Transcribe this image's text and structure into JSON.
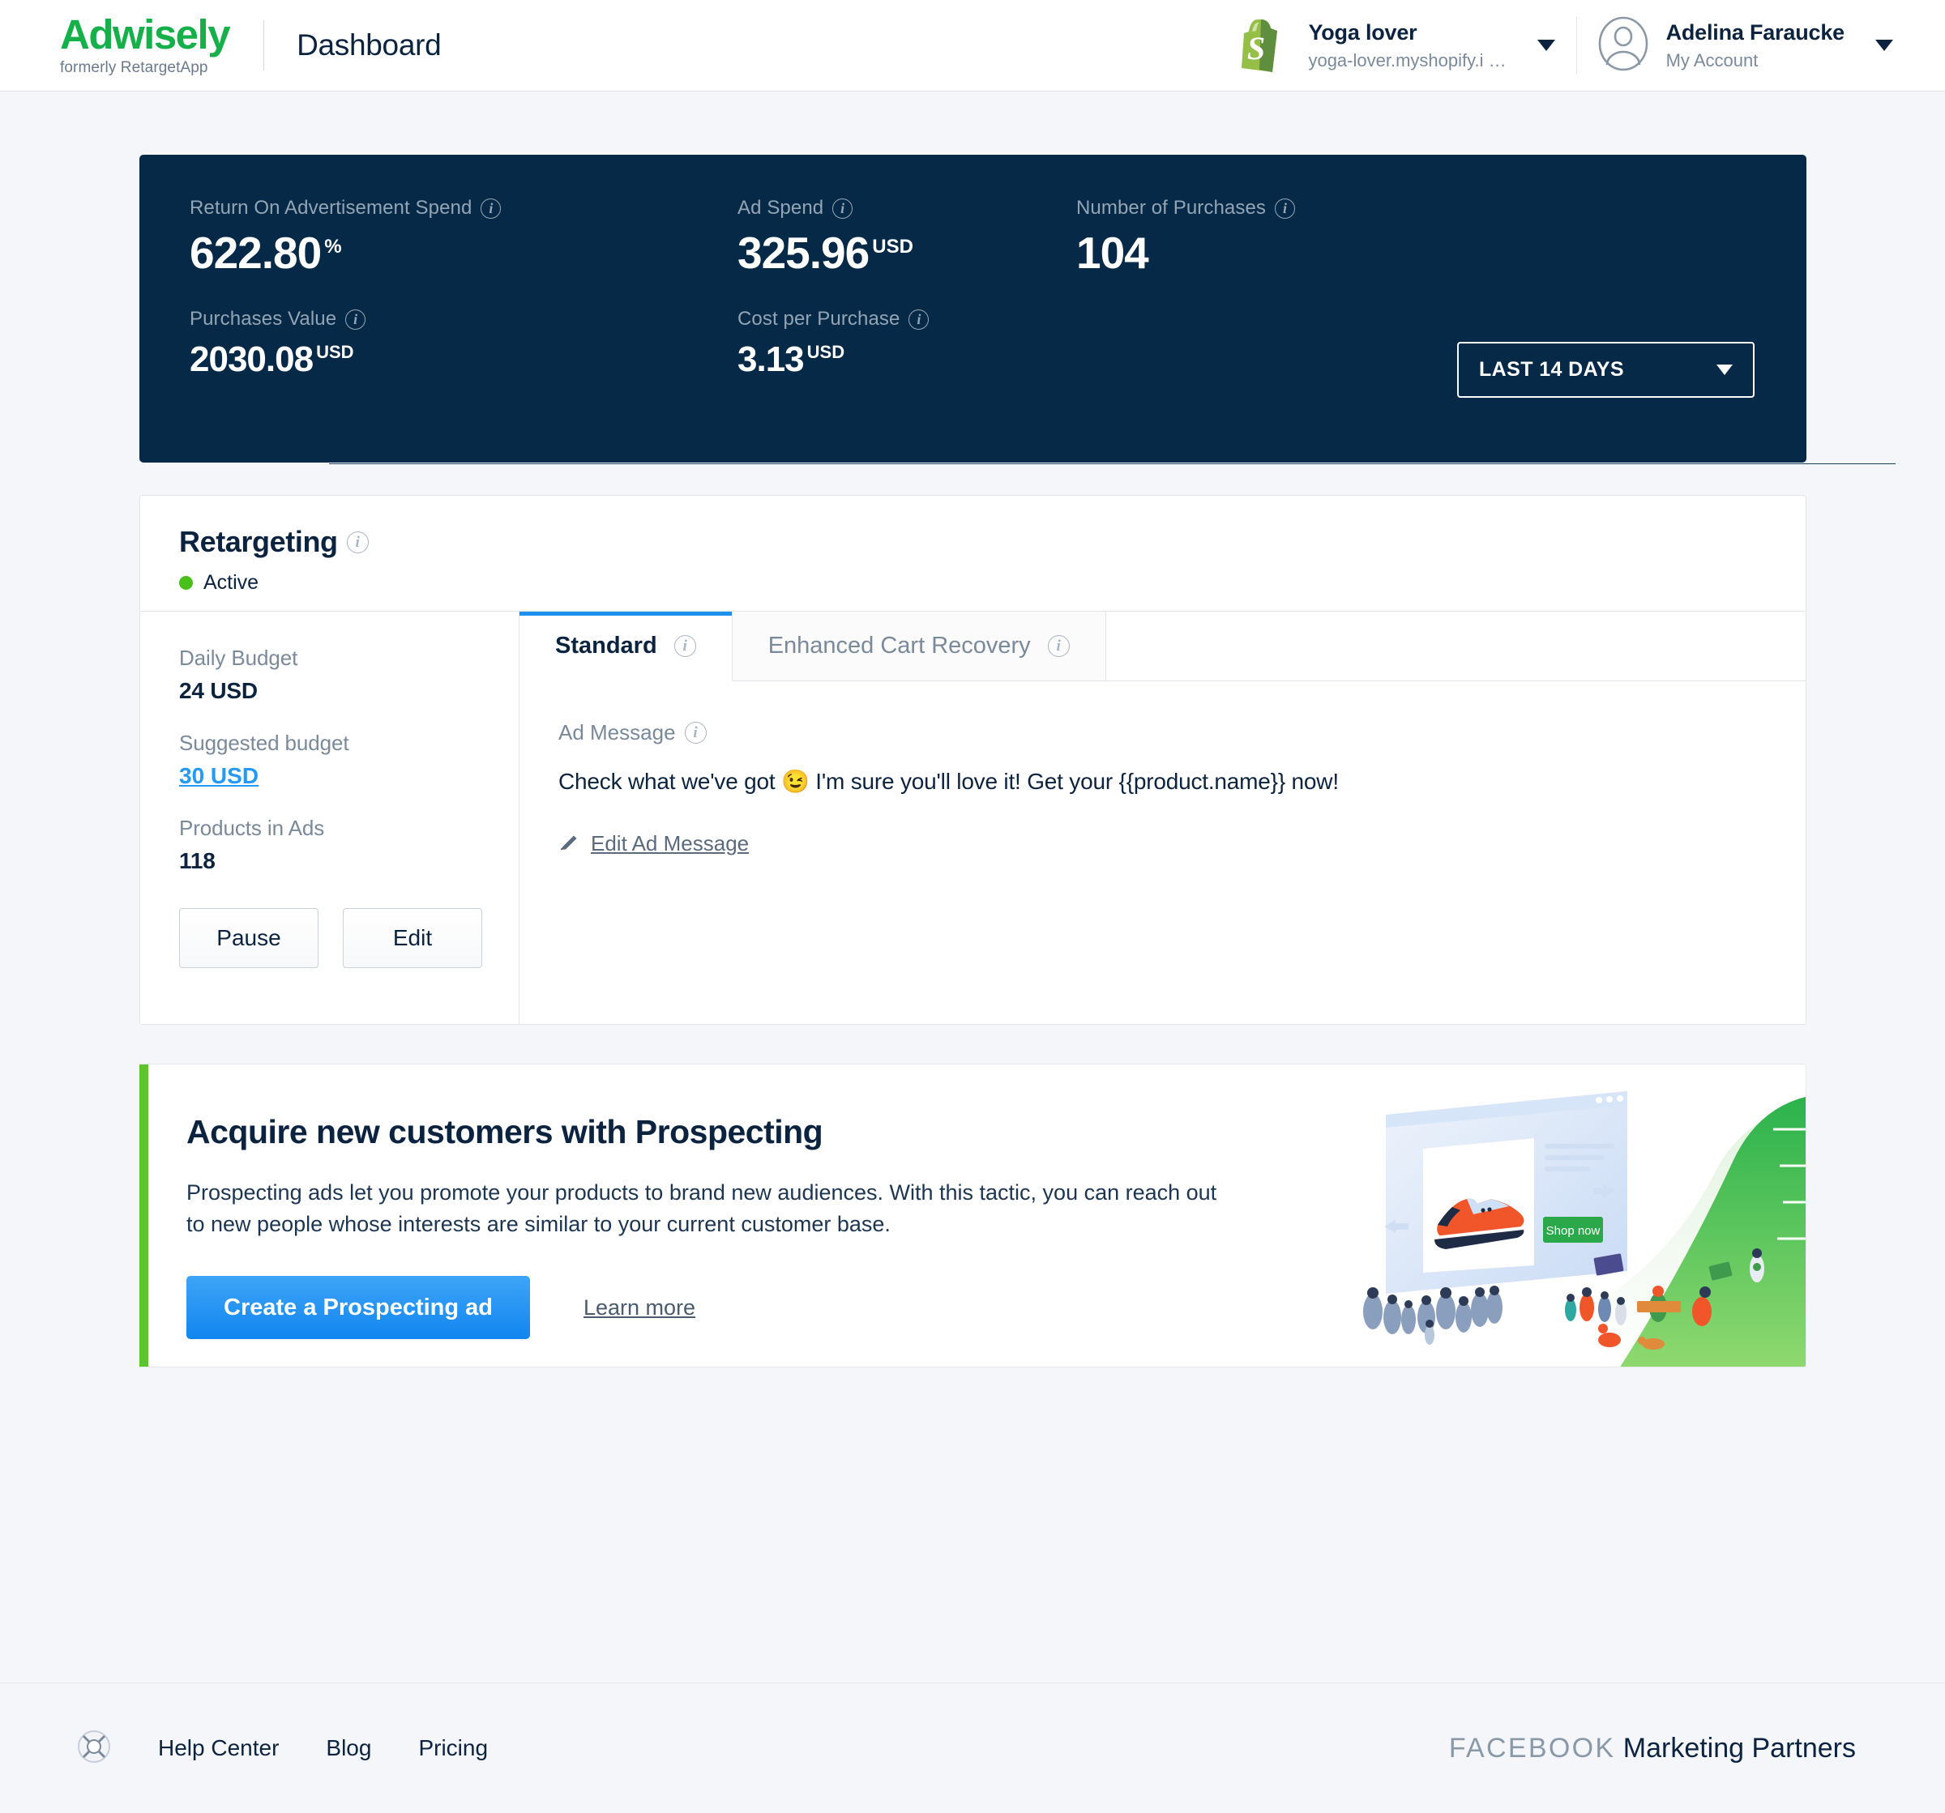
{
  "header": {
    "logo_word": "Adwisely",
    "logo_sub": "formerly RetargetApp",
    "page_title": "Dashboard",
    "store": {
      "name": "Yoga lover",
      "domain": "yoga-lover.myshopify.i …"
    },
    "account": {
      "name": "Adelina Faraucke",
      "sub": "My Account"
    }
  },
  "stats": {
    "date_range": "LAST 14 DAYS",
    "items": [
      {
        "label": "Return On Advertisement Spend",
        "value": "622.80",
        "unit": "%"
      },
      {
        "label": "Ad Spend",
        "value": "325.96",
        "unit": "USD"
      },
      {
        "label": "Number of Purchases",
        "value": "104",
        "unit": ""
      },
      {
        "label": "Purchases Value",
        "value": "2030.08",
        "unit": "USD"
      },
      {
        "label": "Cost per Purchase",
        "value": "3.13",
        "unit": "USD"
      }
    ]
  },
  "retargeting": {
    "title": "Retargeting",
    "status": "Active",
    "fields": [
      {
        "label": "Daily Budget",
        "value": "24 USD"
      },
      {
        "label": "Suggested budget",
        "value": "30 USD"
      },
      {
        "label": "Products in Ads",
        "value": "118"
      }
    ],
    "buttons": {
      "pause": "Pause",
      "edit": "Edit"
    },
    "tabs": [
      {
        "label": "Standard",
        "active": true
      },
      {
        "label": "Enhanced Cart Recovery",
        "active": false
      }
    ],
    "ad_message_label": "Ad Message",
    "ad_message": "Check what we've got 😉 I'm sure you'll love it! Get your {{product.name}} now!",
    "edit_ad_message": "Edit Ad Message"
  },
  "prospecting": {
    "title": "Acquire new customers with Prospecting",
    "text": "Prospecting ads let you promote your products to brand new audiences. With this tactic, you can reach out to new people whose interests are similar to your current customer base.",
    "cta": "Create a Prospecting ad",
    "learn_more": "Learn more",
    "illustration_cta": "Shop now"
  },
  "footer": {
    "links": [
      "Help Center",
      "Blog",
      "Pricing"
    ],
    "partner_brand": "FACEBOOK",
    "partner_text": "Marketing Partners"
  },
  "colors": {
    "brand_green": "#16b04a",
    "panel_navy": "#052946",
    "accent_blue": "#1e90f0",
    "status_green": "#49c018",
    "bar_green": "#5ec42c"
  }
}
